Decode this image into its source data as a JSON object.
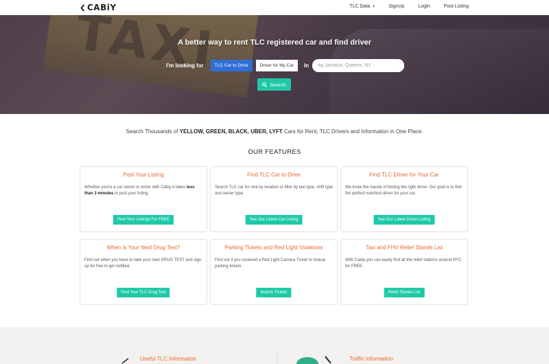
{
  "brand": {
    "name": "CABiY"
  },
  "nav": {
    "items": [
      "TLC Data",
      "SignUp",
      "LogIn",
      "Post Listing"
    ]
  },
  "hero": {
    "title": "A better way to rent TLC registered car and find driver",
    "looking_label": "I'm looking for",
    "option_car": "TLC Car to Drive",
    "option_driver": "Driver for My Car",
    "in_label": "In",
    "location_placeholder": "eg.Jamaica, Queens, NY",
    "search_label": "Search"
  },
  "tagline": {
    "prefix": "Search Thousands of",
    "bold": "YELLOW, GREEN, BLACK, UBER, LYFT",
    "suffix": "Cars for Rent, TLC Drivers and Information in One Place."
  },
  "features": {
    "title": "OUR FEATURES",
    "cards": [
      {
        "title": "Post Your Listing",
        "text_a": "Whether you're a car owner or driver with Cabiy it takes",
        "text_bold": "less than 3 minutes",
        "text_b": "to post your listing.",
        "cta": "Post Your Listings For FREE"
      },
      {
        "title": "Find TLC Car to Drive",
        "text": "Search TLC car for rent by location or filter by taxi type, shift type and owner type.",
        "cta": "See Our Latest Car Listing"
      },
      {
        "title": "Find TLC Driver for Your Car",
        "text": "We know the hassle of finding the right driver. Our goal is to find the perfect matched driver for your car.",
        "cta": "See Our Latest Driver Listing"
      },
      {
        "title": "When is Your Next Drug Test?",
        "text": "Find out when you have to take your next DRUG TEST and sign up for free to get notified.",
        "cta": "Find Your TLC Drug Test"
      },
      {
        "title": "Parking Tickets and Red Light Violations",
        "text": "Find out if you received a Red Light Camera Ticket or lookup parking tickets.",
        "cta": "Search Tickets"
      },
      {
        "title": "Taxi and FHV Relief Stands List",
        "text": "With Cabiy you can easily find all the relief stations around NYC for FREE.",
        "cta": "Relief Stands List"
      }
    ]
  },
  "info": {
    "left_title": "Useful TLC Information",
    "right_title": "Traffic Information"
  },
  "colors": {
    "accent": "#1fc9a8",
    "title": "#e8662a",
    "primary": "#2f6fd6"
  },
  "icons": [
    "car-logo-icon",
    "chevron-down-icon",
    "search-icon",
    "document-icon",
    "traffic-map-icon"
  ]
}
